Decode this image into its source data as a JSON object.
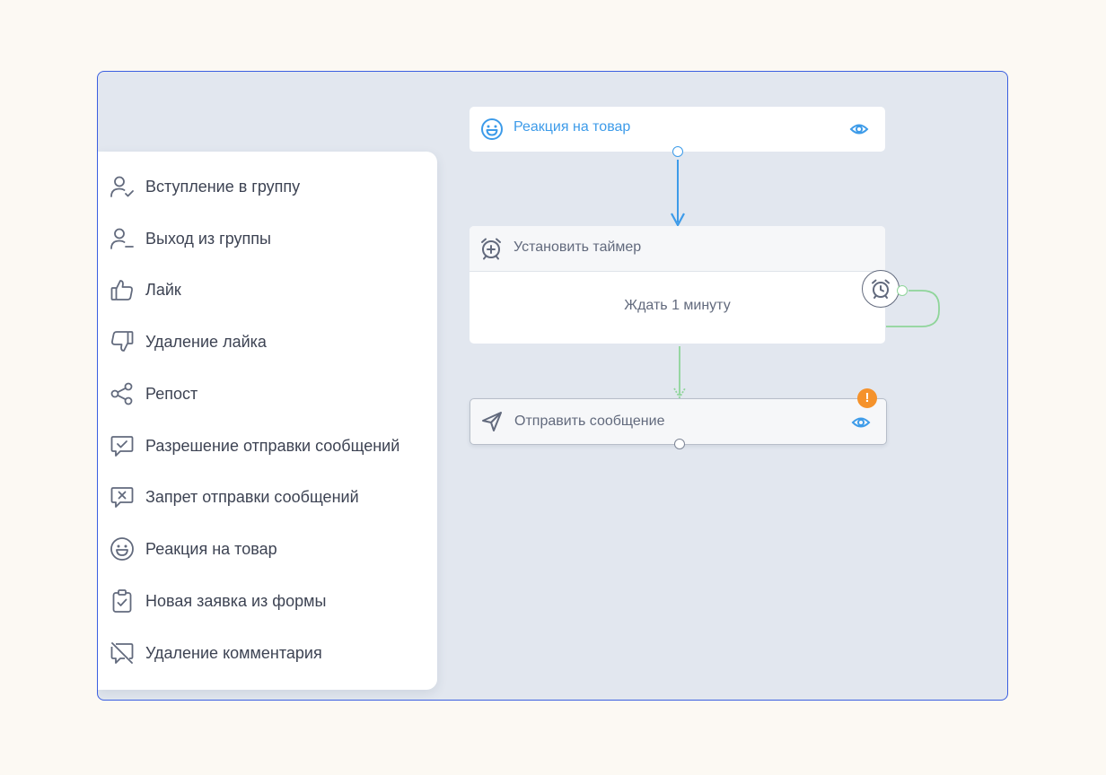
{
  "sidebar": {
    "items": [
      {
        "label": "Вступление в группу",
        "icon": "user-check-icon"
      },
      {
        "label": "Выход из группы",
        "icon": "user-minus-icon"
      },
      {
        "label": "Лайк",
        "icon": "thumbs-up-icon"
      },
      {
        "label": "Удаление лайка",
        "icon": "thumbs-down-icon"
      },
      {
        "label": "Репост",
        "icon": "share-icon"
      },
      {
        "label": "Разрешение отправки сообщений",
        "icon": "message-check-icon"
      },
      {
        "label": "Запрет отправки сообщений",
        "icon": "message-x-icon"
      },
      {
        "label": "Реакция на товар",
        "icon": "smile-icon"
      },
      {
        "label": "Новая заявка из формы",
        "icon": "clipboard-check-icon"
      },
      {
        "label": "Удаление комментария",
        "icon": "message-off-icon"
      }
    ]
  },
  "flow": {
    "trigger": {
      "title": "Реакция на товар",
      "icon": "smile-icon"
    },
    "timer": {
      "title": "Установить таймер",
      "body": "Ждать 1 минуту",
      "icon": "alarm-plus-icon"
    },
    "message": {
      "title": "Отправить сообщение",
      "icon": "send-icon",
      "warning": "!"
    }
  },
  "colors": {
    "frame": "#3b5fe0",
    "canvas_bg": "#e2e7ef",
    "accent_blue": "#3d9be9",
    "green_wire": "#8fd59a",
    "warning": "#f5922b",
    "text": "#3d4353",
    "muted_text": "#626a7d"
  }
}
